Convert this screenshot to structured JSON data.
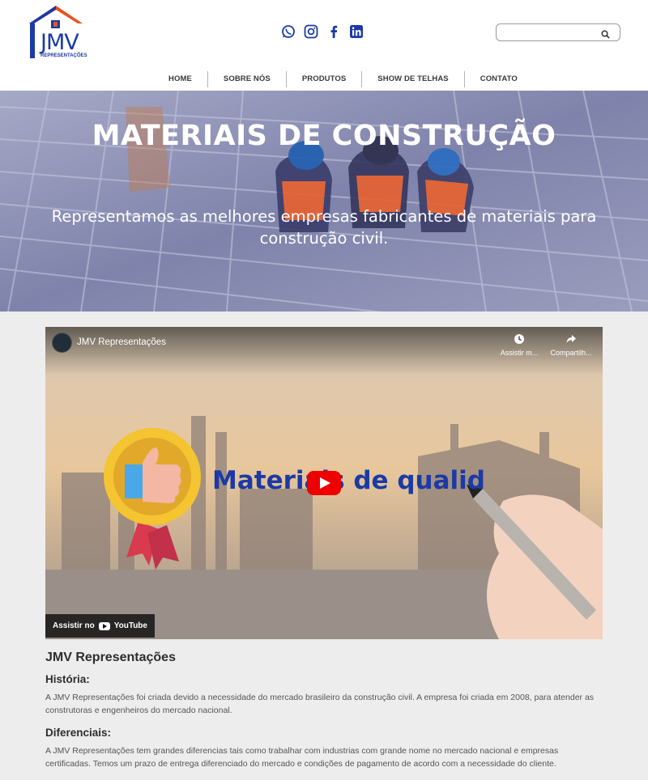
{
  "header": {
    "logo": {
      "text": "JMV",
      "subtext": "REPRESENTAÇÕES"
    },
    "social": [
      {
        "icon": "whatsapp-icon"
      },
      {
        "icon": "instagram-icon"
      },
      {
        "icon": "facebook-icon"
      },
      {
        "icon": "linkedin-icon"
      }
    ],
    "search": {
      "placeholder": ""
    }
  },
  "nav": {
    "items": [
      "HOME",
      "SOBRE NÓS",
      "PRODUTOS",
      "SHOW DE TELHAS",
      "CONTATO"
    ]
  },
  "hero": {
    "title": "MATERIAIS DE CONSTRUÇÃO",
    "subtitle": "Representamos as melhores empresas fabricantes de materiais para construção civil."
  },
  "video": {
    "channel_title": "JMV Representações",
    "watch_later_label": "Assistir m...",
    "share_label": "Compartilh...",
    "overlay_text": "Materiais de qualid",
    "watch_on_label": "Assistir no",
    "youtube_label": "YouTube"
  },
  "content": {
    "heading": "JMV Representações",
    "sections": [
      {
        "title": "História:",
        "text": "A JMV Representações foi criada devido a necessidade do mercado brasileiro da construção civil. A empresa foi criada em 2008, para atender as construtoras e engenheiros do mercado nacional."
      },
      {
        "title": "Diferenciais:",
        "text": "A JMV Representações tem grandes diferencias tais como trabalhar com industrias com grande nome no mercado nacional e empresas certificadas. Temos um prazo de entrega diferenciado do mercado e condições de pagamento de acordo com a necessidade do cliente."
      }
    ]
  },
  "colors": {
    "brand_blue": "#1b3aa6",
    "brand_orange": "#e8531f",
    "play_red": "#ee0000"
  }
}
